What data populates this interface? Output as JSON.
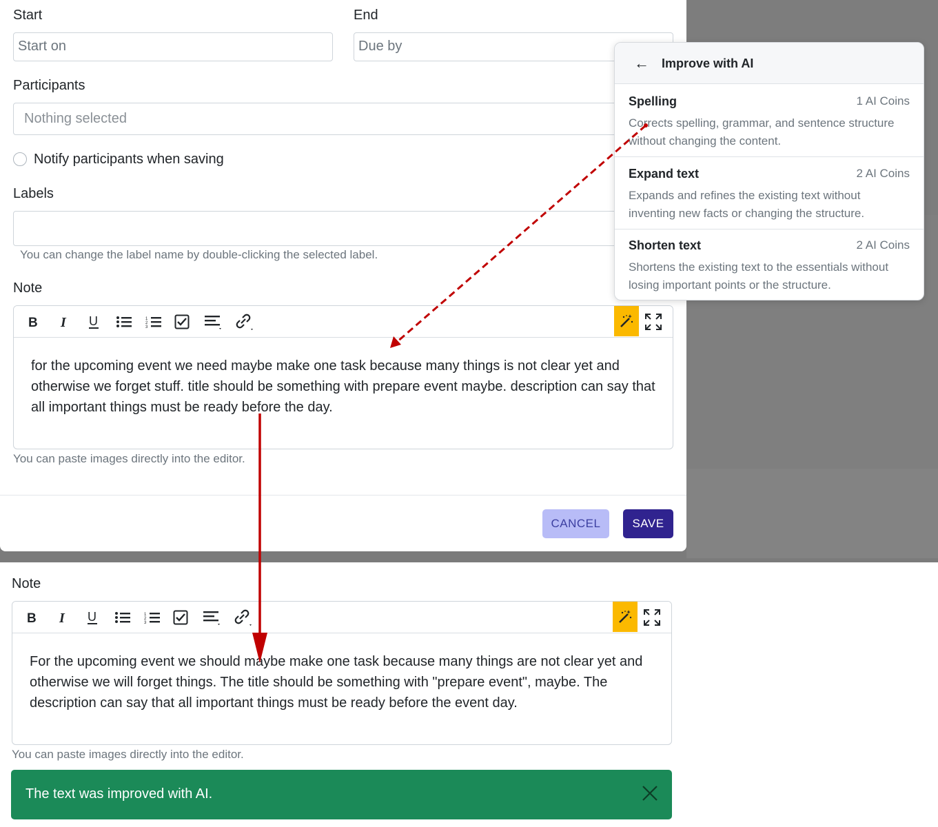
{
  "form": {
    "start_label": "Start",
    "start_placeholder": "Start on",
    "end_label": "End",
    "end_placeholder": "Due by",
    "participants_label": "Participants",
    "participants_value": "Nothing selected",
    "notify_label": "Notify participants when saving",
    "labels_label": "Labels",
    "labels_help": "You can change the label name by double-clicking the selected label.",
    "note_label": "Note",
    "note_text": "for the upcoming event we need maybe make one task because many things is not clear yet and otherwise we forget stuff. title should be something with prepare event maybe. description can say that all important things must be ready before the day.",
    "note_help": "You can paste images directly into the editor.",
    "cancel_label": "CANCEL",
    "save_label": "SAVE"
  },
  "ai_menu": {
    "title": "Improve with AI",
    "options": [
      {
        "name": "Spelling",
        "cost": "1 AI Coins",
        "description": "Corrects spelling, grammar, and sentence structure without changing the content."
      },
      {
        "name": "Expand text",
        "cost": "2 AI Coins",
        "description": "Expands and refines the existing text without inventing new facts or changing the structure."
      },
      {
        "name": "Shorten text",
        "cost": "2 AI Coins",
        "description": "Shortens the existing text to the essentials without losing important points or the structure."
      }
    ]
  },
  "result": {
    "note_label": "Note",
    "note_text": "For the upcoming event we should maybe make one task because many things are not clear yet and otherwise we will forget things. The title should be something with \"prepare event\", maybe. The description can say that all important things must be ready before the event day.",
    "note_help": "You can paste images directly into the editor.",
    "toast_message": "The text was improved with AI."
  },
  "toolbar_icons": [
    "bold-icon",
    "italic-icon",
    "underline-icon",
    "bullet-list-icon",
    "numbered-list-icon",
    "checklist-icon",
    "align-icon",
    "link-icon",
    "magic-wand-icon",
    "fullscreen-icon"
  ],
  "colors": {
    "ai_button": "#fbb900",
    "save_button": "#30238f",
    "cancel_button": "#b8bcf7",
    "toast": "#1b8a58",
    "annotation_arrow": "#c00000"
  }
}
